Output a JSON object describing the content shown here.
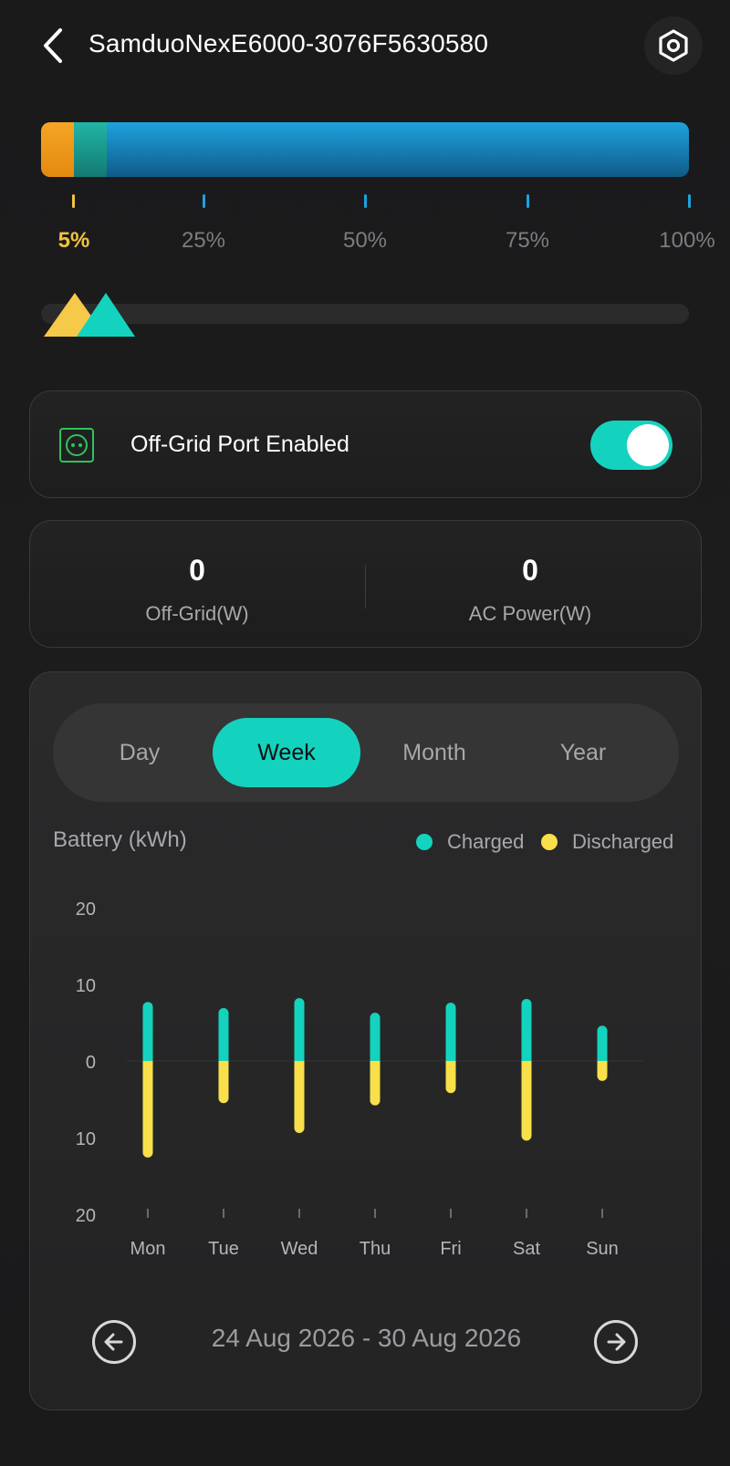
{
  "header": {
    "title": "SamduoNexE6000-3076F5630580",
    "back_icon": "chevron-left-icon",
    "settings_icon": "hex-nut-icon"
  },
  "battery": {
    "level_fraction": 0.05,
    "backup_fraction": 0.1,
    "colors": {
      "low": "#f6a524",
      "reserve": "#22b6a5",
      "fill": "#1ea2dc"
    },
    "scale_labels": [
      "5%",
      "25%",
      "50%",
      "75%",
      "100%"
    ],
    "active_label_index": 0,
    "slider_markers": [
      {
        "name": "discharge-limit",
        "color": "#f7c948",
        "value": 5
      },
      {
        "name": "backup-reserve",
        "color": "#14d3be",
        "value": 10
      }
    ]
  },
  "port": {
    "icon": "socket-icon",
    "label": "Off-Grid Port Enabled",
    "enabled": true
  },
  "power": {
    "off_grid": {
      "value": "0",
      "label": "Off-Grid(W)"
    },
    "ac": {
      "value": "0",
      "label": "AC Power(W)"
    }
  },
  "period_tabs": [
    "Day",
    "Week",
    "Month",
    "Year"
  ],
  "active_tab": "Week",
  "chart": {
    "title": "Battery (kWh)",
    "legend": {
      "charged": "Charged",
      "discharged": "Discharged"
    }
  },
  "chart_data": {
    "type": "bar",
    "title": "Battery (kWh)",
    "categories": [
      "Mon",
      "Tue",
      "Wed",
      "Thu",
      "Fri",
      "Sat",
      "Sun"
    ],
    "series": [
      {
        "name": "Charged",
        "color": "#14d3be",
        "values": [
          7.7,
          6.9,
          8.2,
          6.3,
          7.6,
          8.1,
          4.6
        ]
      },
      {
        "name": "Discharged",
        "color": "#f7e04a",
        "values": [
          12.6,
          5.5,
          9.4,
          5.8,
          4.2,
          10.4,
          2.6
        ]
      }
    ],
    "y_tick_labels": [
      "20",
      "10",
      "0",
      "10",
      "20"
    ],
    "ylim": [
      -20,
      20
    ],
    "grid": false,
    "legend_position": "top-right"
  },
  "date_nav": {
    "range": "24 Aug 2026 - 30 Aug 2026",
    "prev_icon": "arrow-left-circle-icon",
    "next_icon": "arrow-right-circle-icon"
  }
}
